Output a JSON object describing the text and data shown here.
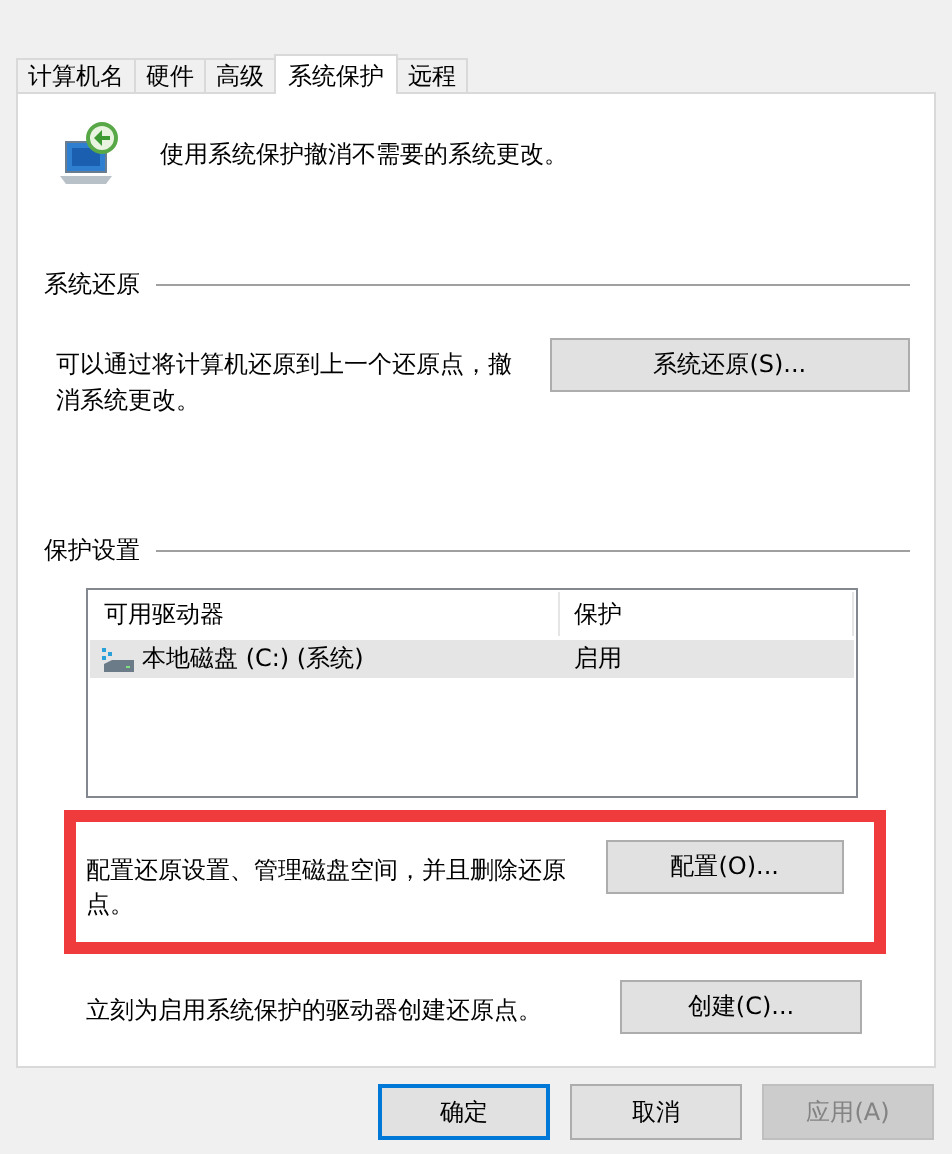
{
  "tabs": [
    {
      "label": "计算机名",
      "selected": false
    },
    {
      "label": "硬件",
      "selected": false
    },
    {
      "label": "高级",
      "selected": false
    },
    {
      "label": "系统保护",
      "selected": true
    },
    {
      "label": "远程",
      "selected": false
    }
  ],
  "intro": "使用系统保护撤消不需要的系统更改。",
  "system_restore": {
    "heading": "系统还原",
    "description": "可以通过将计算机还原到上一个还原点，撤消系统更改。",
    "button": "系统还原(S)..."
  },
  "protection": {
    "heading": "保护设置",
    "table": {
      "columns": [
        "可用驱动器",
        "保护"
      ],
      "rows": [
        {
          "drive": "本地磁盘 (C:) (系统)",
          "protection": "启用",
          "selected": true
        }
      ]
    },
    "configure": {
      "text": "配置还原设置、管理磁盘空间，并且删除还原点。",
      "button": "配置(O)...",
      "highlighted": true
    },
    "create": {
      "text": "立刻为启用系统保护的驱动器创建还原点。",
      "button": "创建(C)..."
    }
  },
  "buttons": [
    {
      "label": "确定",
      "default": true,
      "disabled": false
    },
    {
      "label": "取消",
      "default": false,
      "disabled": false
    },
    {
      "label": "应用(A)",
      "default": false,
      "disabled": true
    }
  ]
}
